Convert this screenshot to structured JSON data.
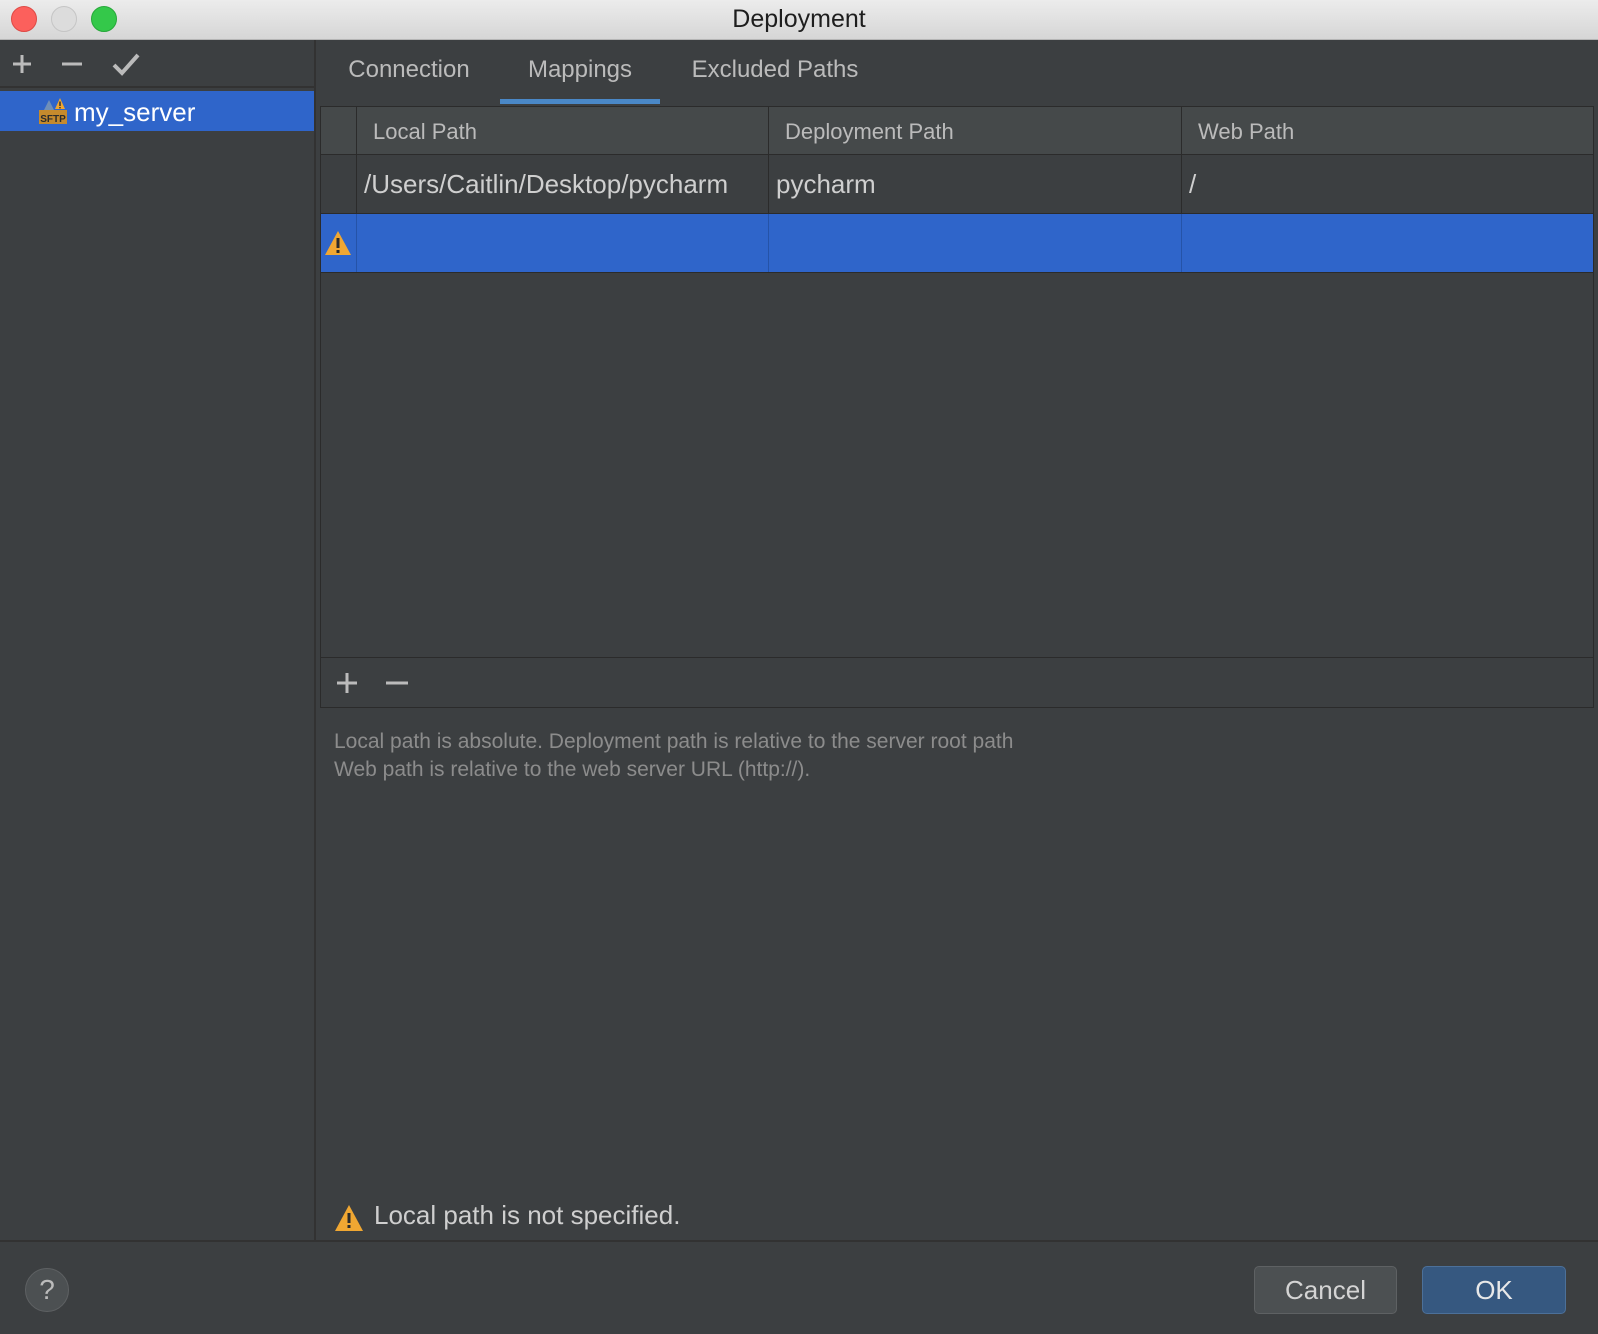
{
  "window": {
    "title": "Deployment"
  },
  "sidebar": {
    "toolbar": {
      "add": "+",
      "remove": "−",
      "apply": "✓"
    },
    "servers": [
      {
        "label": "my_server",
        "icon": "sftp-warning-icon",
        "selected": true
      }
    ]
  },
  "tabs": [
    {
      "label": "Connection",
      "active": false
    },
    {
      "label": "Mappings",
      "active": true
    },
    {
      "label": "Excluded Paths",
      "active": false
    }
  ],
  "table": {
    "columns": [
      "Local Path",
      "Deployment Path",
      "Web Path"
    ],
    "rows": [
      {
        "local": "/Users/Caitlin/Desktop/pycharm",
        "deploy": "pycharm",
        "web": "/",
        "warning": false
      },
      {
        "local": "",
        "deploy": "",
        "web": "",
        "warning": true,
        "selected": true
      }
    ]
  },
  "hint": {
    "line1": "Local path is absolute. Deployment path is relative to the server root path",
    "line2": "Web path is relative to the web server URL (http://)."
  },
  "error": {
    "text": "Local path is not specified."
  },
  "footer": {
    "help": "?",
    "cancel": "Cancel",
    "ok": "OK"
  },
  "colors": {
    "selection": "#2f65ca",
    "accent": "#4a88c7",
    "warning": "#f0a732",
    "ok_button": "#365880"
  }
}
